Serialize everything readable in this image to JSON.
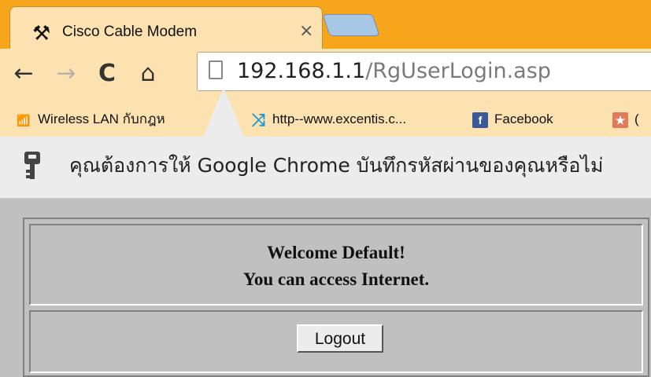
{
  "tab": {
    "title": "Cisco Cable Modem",
    "favicon": "tools-icon",
    "close_label": "×"
  },
  "toolbar": {
    "back_glyph": "←",
    "forward_glyph": "→",
    "reload_glyph": "C",
    "home_glyph": "⌂",
    "url_host": "192.168.1.1",
    "url_path": "/RgUserLogin.asp"
  },
  "bookmarks": [
    {
      "label": "Wireless LAN กับกฎห",
      "icon": "wifi-icon"
    },
    {
      "label": "http--www.excentis.c...",
      "icon": "excentis-icon"
    },
    {
      "label": "Facebook",
      "icon": "facebook-icon"
    },
    {
      "label": "(",
      "icon": "bookmark-icon"
    }
  ],
  "infobar": {
    "message": "คุณต้องการให้ Google Chrome บันทึกรหัสผ่านของคุณหรือไม่",
    "icon": "key-icon"
  },
  "page": {
    "welcome_line1": "Welcome Default!",
    "welcome_line2": "You can access Internet.",
    "logout_label": "Logout"
  },
  "colors": {
    "tabstrip": "#f7a51b",
    "toolbar": "#fbe2b0",
    "page_bg": "#c0c0c0"
  }
}
